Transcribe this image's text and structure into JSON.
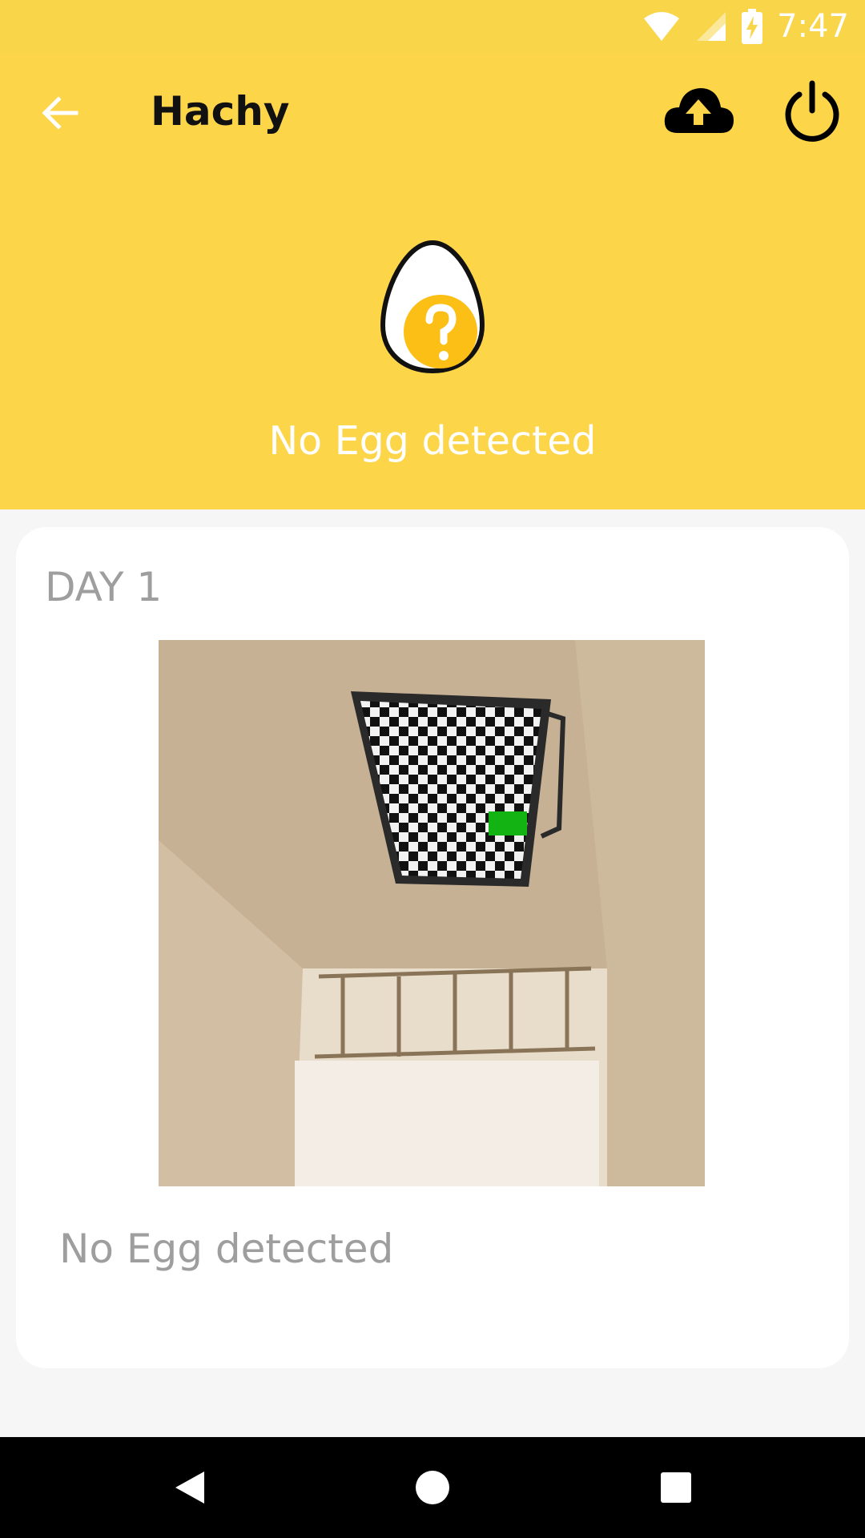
{
  "status_bar": {
    "time": "7:47",
    "icons": [
      "wifi-icon",
      "cell-signal-icon",
      "battery-charging-icon"
    ]
  },
  "header": {
    "title": "Hachy",
    "back_icon": "arrow-back-icon",
    "upload_icon": "cloud-upload-icon",
    "power_icon": "power-icon",
    "status_icon": "egg-question-icon",
    "status_text": "No Egg detected"
  },
  "card": {
    "day_label": "DAY 1",
    "image_description": "camera-snapshot",
    "status_text": "No Egg detected"
  },
  "nav_bar": {
    "icons": [
      "back-triangle-icon",
      "home-circle-icon",
      "recents-square-icon"
    ]
  },
  "colors": {
    "header_yellow": "#fdd549",
    "status_bar_yellow": "#f9d54a",
    "egg_accent": "#fbbf16",
    "card_text_gray": "#9e9e9e"
  }
}
